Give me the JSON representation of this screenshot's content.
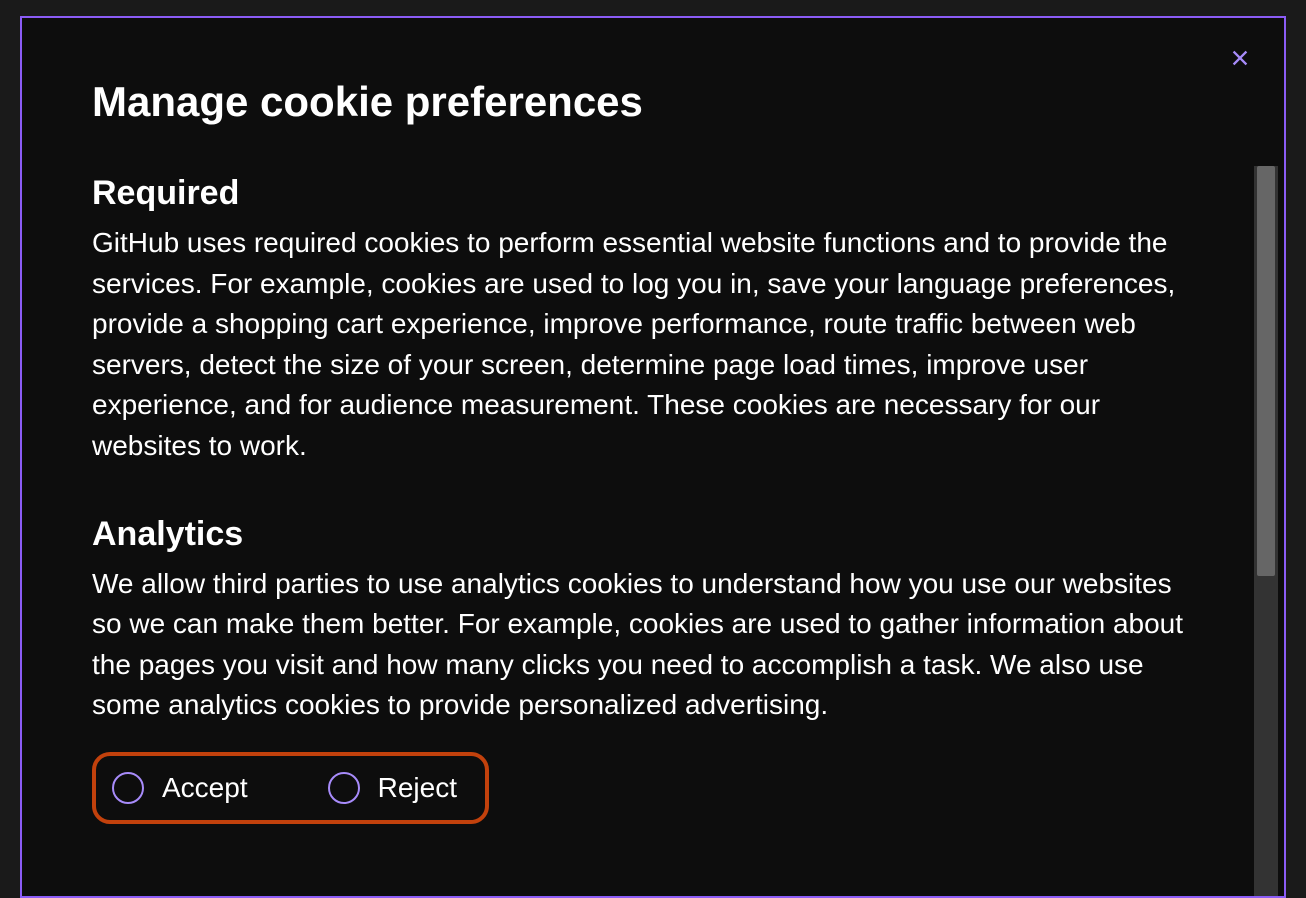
{
  "modal": {
    "title": "Manage cookie preferences",
    "sections": [
      {
        "heading": "Required",
        "body": "GitHub uses required cookies to perform essential website functions and to provide the services. For example, cookies are used to log you in, save your language preferences, provide a shopping cart experience, improve performance, route traffic between web servers, detect the size of your screen, determine page load times, improve user experience, and for audience measurement. These cookies are necessary for our websites to work."
      },
      {
        "heading": "Analytics",
        "body": "We allow third parties to use analytics cookies to understand how you use our websites so we can make them better. For example, cookies are used to gather information about the pages you visit and how many clicks you need to accomplish a task. We also use some analytics cookies to provide personalized advertising."
      }
    ],
    "radios": {
      "accept": "Accept",
      "reject": "Reject"
    }
  },
  "colors": {
    "accent": "#8b5cf6",
    "highlight_border": "#c2410c"
  }
}
